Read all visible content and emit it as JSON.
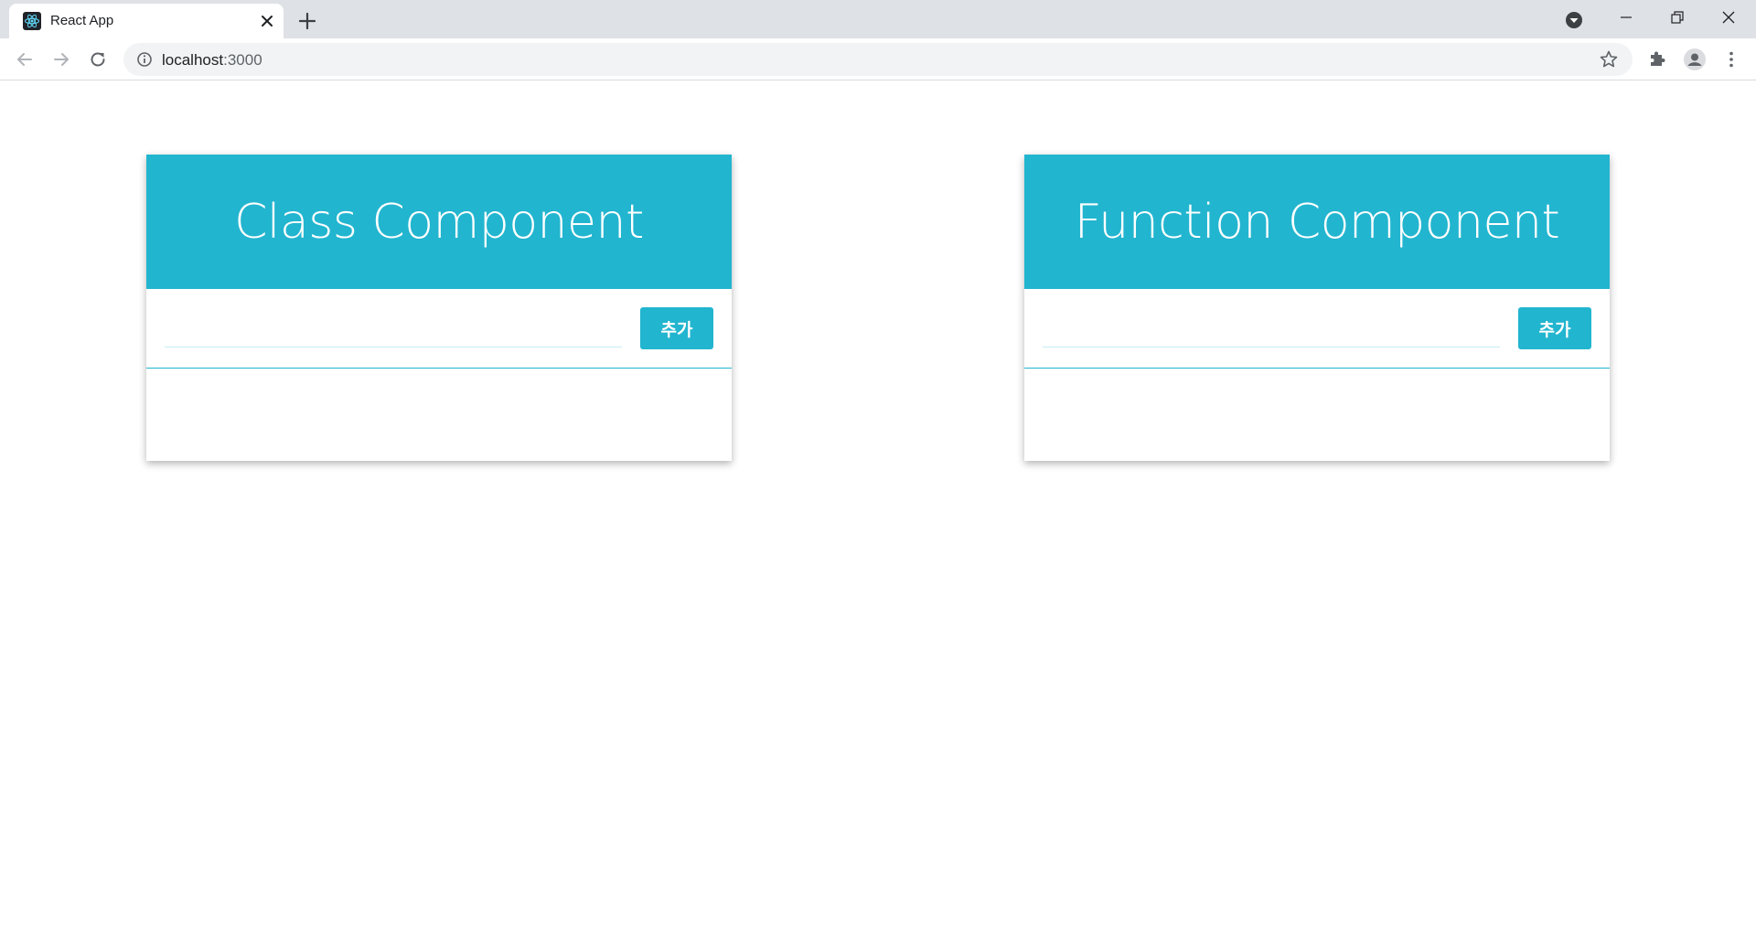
{
  "browser": {
    "tab_title": "React App",
    "url_host": "localhost",
    "url_port": ":3000",
    "icons": {
      "favicon": "react-logo-icon",
      "tab_close": "close-icon",
      "new_tab": "plus-icon",
      "tab_search": "chevron-down-circle-icon",
      "minimize": "minimize-icon",
      "restore": "restore-icon",
      "close_window": "close-icon",
      "back": "arrow-left-icon",
      "forward": "arrow-right-icon",
      "reload": "reload-icon",
      "site_info": "info-icon",
      "bookmark": "star-icon",
      "extensions": "puzzle-icon",
      "profile": "account-icon",
      "menu": "kebab-menu-icon"
    }
  },
  "app": {
    "colors": {
      "accent": "#22b5cf",
      "input_underline": "#c9eef4"
    },
    "cards": [
      {
        "title": "Class Component",
        "input_value": "",
        "button_label": "추가",
        "items": []
      },
      {
        "title": "Function Component",
        "input_value": "",
        "button_label": "추가",
        "items": []
      }
    ]
  }
}
